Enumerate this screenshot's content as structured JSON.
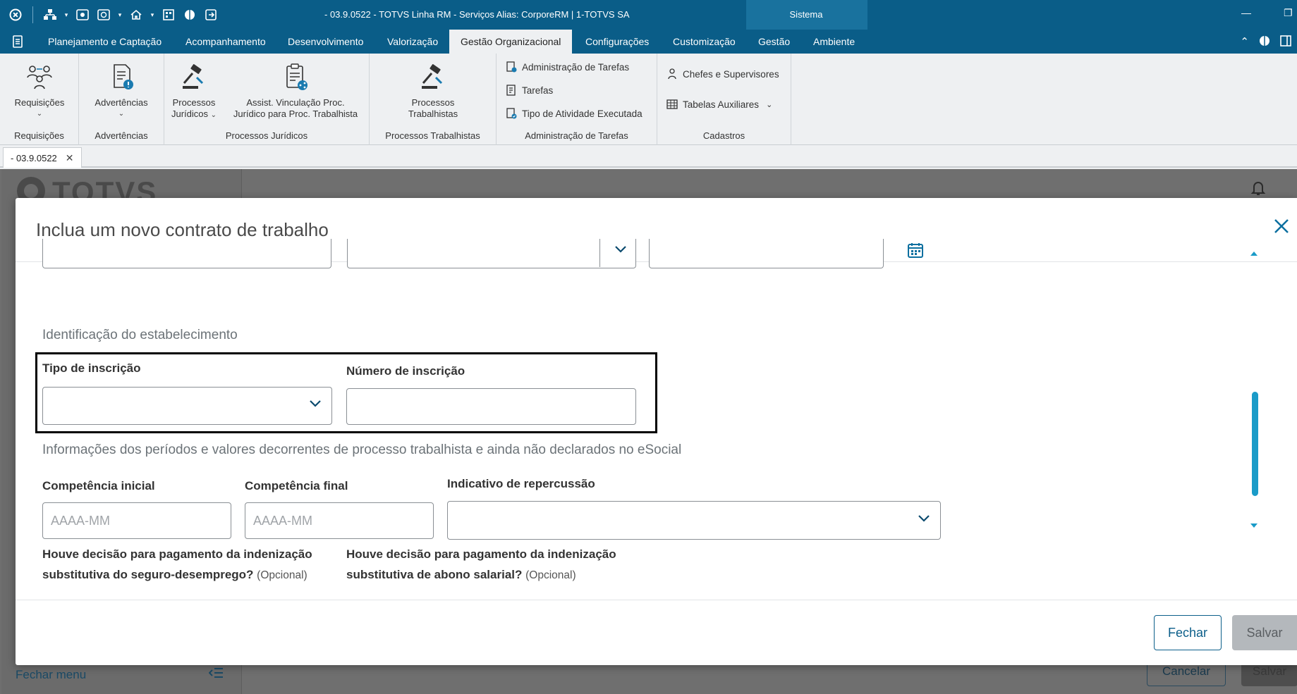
{
  "window": {
    "title": "- 03.9.0522 - TOTVS Linha RM - Serviços  Alias: CorporeRM | 1-TOTVS SA",
    "system_tab": "Sistema"
  },
  "menu": {
    "tabs": [
      "Planejamento e Captação",
      "Acompanhamento",
      "Desenvolvimento",
      "Valorização",
      "Gestão Organizacional",
      "Configurações",
      "Customização",
      "Gestão",
      "Ambiente"
    ],
    "active": "Gestão Organizacional"
  },
  "ribbon": {
    "groups": {
      "requisicoes": {
        "label": "Requisições",
        "button": "Requisições"
      },
      "advertencias": {
        "label": "Advertências",
        "button": "Advertências"
      },
      "processos_juridicos": {
        "label": "Processos Jurídicos",
        "button1_l1": "Processos",
        "button1_l2": "Jurídicos",
        "button2_l1": "Assist. Vinculação Proc.",
        "button2_l2": "Jurídico para Proc. Trabalhista"
      },
      "processos_trabalhistas": {
        "label": "Processos Trabalhistas",
        "button_l1": "Processos",
        "button_l2": "Trabalhistas"
      },
      "admin_tarefas": {
        "label": "Administração de Tarefas",
        "items": [
          "Administração de Tarefas",
          "Tarefas",
          "Tipo de Atividade Executada"
        ]
      },
      "cadastros": {
        "label": "Cadastros",
        "items": [
          "Chefes e Supervisores",
          "Tabelas Auxiliares"
        ]
      }
    }
  },
  "doc_tab": {
    "label": "- 03.9.0522"
  },
  "workspace": {
    "fechar_menu": "Fechar menu",
    "cancelar": "Cancelar",
    "salvar": "Salvar"
  },
  "modal": {
    "title": "Inclua um novo contrato de trabalho",
    "section_estabelecimento": "Identificação do estabelecimento",
    "tipo_inscricao_label": "Tipo de inscrição",
    "numero_inscricao_label": "Número de inscrição",
    "section_periodos": "Informações dos períodos e valores decorrentes de processo trabalhista e ainda não declarados no eSocial",
    "competencia_inicial_label": "Competência inicial",
    "competencia_final_label": "Competência final",
    "indicativo_label": "Indicativo de repercussão",
    "competencia_placeholder": "AAAA-MM",
    "decisao_seguro_l1": "Houve decisão para pagamento da indenização",
    "decisao_seguro_l2": "substitutiva do seguro-desemprego?",
    "decisao_abono_l1": "Houve decisão para pagamento da indenização",
    "decisao_abono_l2": "substitutiva de abono salarial?",
    "opcional": "(Opcional)",
    "fechar": "Fechar",
    "salvar": "Salvar"
  }
}
